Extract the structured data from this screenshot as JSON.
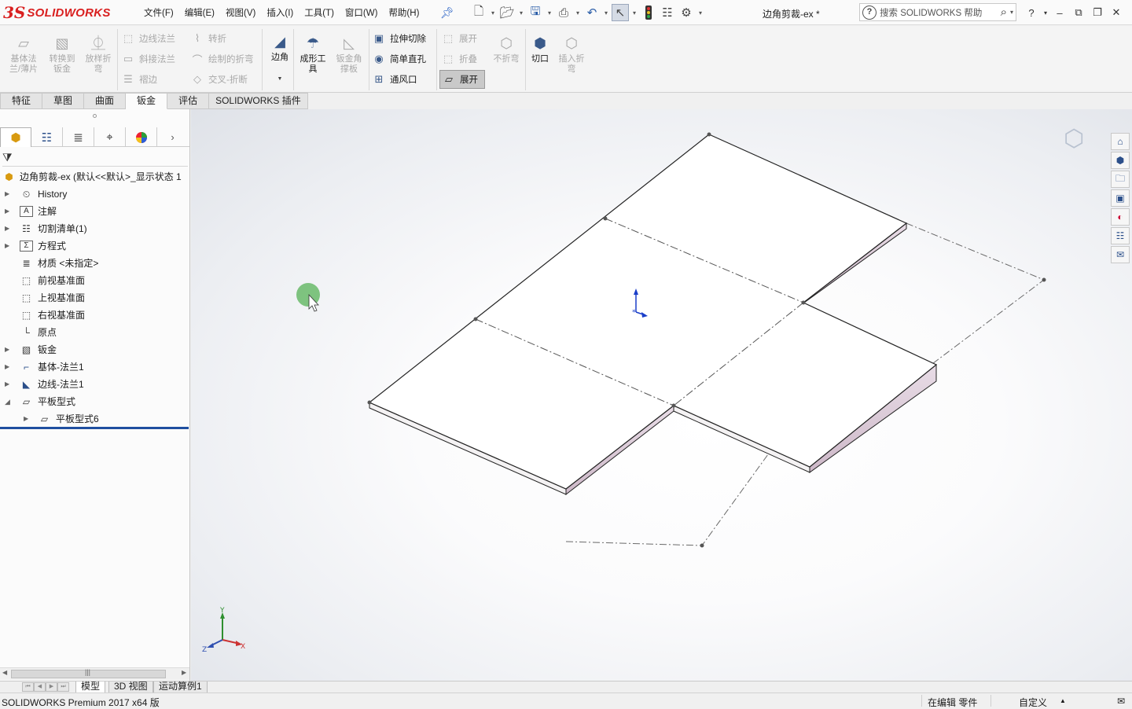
{
  "app": {
    "logo_prefix": "3S",
    "logo_text": "SOLIDWORKS",
    "document_title": "边角剪裁-ex *"
  },
  "menu": {
    "items": [
      "文件(F)",
      "编辑(E)",
      "视图(V)",
      "插入(I)",
      "工具(T)",
      "窗口(W)",
      "帮助(H)"
    ]
  },
  "search": {
    "placeholder": "搜索 SOLIDWORKS 帮助"
  },
  "ribbon": {
    "base_flange": "基体法\n兰/薄片",
    "convert_to_sheetmetal": "转换到\n钣金",
    "lofted_bend": "放样折\n弯",
    "edge_flange": "边线法兰",
    "miter_flange": "斜接法兰",
    "hem": "褶边",
    "jog": "转折",
    "sketched_bend": "绘制的折弯",
    "cross_break": "交叉-折断",
    "corners": "边角",
    "forming_tool": "成形工\n具",
    "sheetmetal_gusset": "钣金角\n撑板",
    "extruded_cut": "拉伸切除",
    "simple_hole": "简单直孔",
    "vent": "通风口",
    "unfold": "展开",
    "fold": "折叠",
    "no_bends": "不折弯",
    "rip": "切口",
    "insert_bends": "插入折\n弯",
    "flatten": "展开"
  },
  "command_tabs": {
    "items": [
      "特征",
      "草图",
      "曲面",
      "钣金",
      "评估",
      "SOLIDWORKS 插件"
    ],
    "active": "钣金"
  },
  "feature_tree": {
    "root": "边角剪裁-ex  (默认<<默认>_显示状态 1",
    "items": [
      {
        "label": "History",
        "icon": "history-icon",
        "expandable": true
      },
      {
        "label": "注解",
        "icon": "annotations-icon",
        "expandable": true
      },
      {
        "label": "切割清单(1)",
        "icon": "cut-list-icon",
        "expandable": true
      },
      {
        "label": "方程式",
        "icon": "equations-icon",
        "expandable": true
      },
      {
        "label": "材质 <未指定>",
        "icon": "material-icon",
        "expandable": false
      },
      {
        "label": "前视基准面",
        "icon": "plane-icon",
        "expandable": false
      },
      {
        "label": "上视基准面",
        "icon": "plane-icon",
        "expandable": false
      },
      {
        "label": "右视基准面",
        "icon": "plane-icon",
        "expandable": false
      },
      {
        "label": "原点",
        "icon": "origin-icon",
        "expandable": false
      },
      {
        "label": "钣金",
        "icon": "sheetmetal-icon",
        "expandable": true
      },
      {
        "label": "基体-法兰1",
        "icon": "base-flange-icon",
        "expandable": true
      },
      {
        "label": "边线-法兰1",
        "icon": "edge-flange-icon",
        "expandable": true
      },
      {
        "label": "平板型式",
        "icon": "flat-pattern-icon",
        "expandable": true,
        "expanded": true
      },
      {
        "label": "平板型式6",
        "icon": "flat-pattern-icon",
        "expandable": true,
        "child": true
      }
    ]
  },
  "bottom_tabs": {
    "items": [
      "模型",
      "3D 视图",
      "运动算例1"
    ],
    "active": "模型"
  },
  "status_bar": {
    "product": "SOLIDWORKS Premium 2017 x64 版",
    "mode": "在编辑 零件",
    "units": "自定义"
  },
  "triad": {
    "x": "X",
    "y": "Y",
    "z": "Z"
  }
}
